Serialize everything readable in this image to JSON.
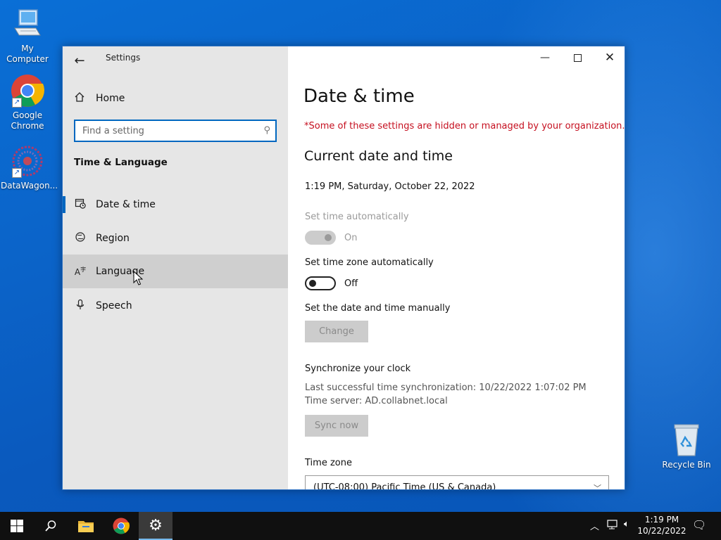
{
  "desktop": {
    "icons": [
      {
        "label": "My Computer",
        "icon": "computer-icon"
      },
      {
        "label": "Google Chrome",
        "icon": "chrome-icon"
      },
      {
        "label": "DataWagon...",
        "icon": "datawagon-icon"
      },
      {
        "label": "Recycle Bin",
        "icon": "recycle-bin-icon"
      }
    ]
  },
  "window": {
    "app_title": "Settings",
    "nav": {
      "home_label": "Home",
      "search_placeholder": "Find a setting",
      "section_title": "Time & Language",
      "items": [
        {
          "label": "Date & time",
          "icon": "date-time-icon",
          "selected": true
        },
        {
          "label": "Region",
          "icon": "region-globe-icon"
        },
        {
          "label": "Language",
          "icon": "language-icon",
          "hovered": true
        },
        {
          "label": "Speech",
          "icon": "microphone-icon"
        }
      ]
    },
    "content": {
      "title": "Date & time",
      "org_note": "*Some of these settings are hidden or managed by your organization.",
      "section_heading": "Current date and time",
      "current_datetime": "1:19 PM, Saturday, October 22, 2022",
      "set_time_auto": {
        "label": "Set time automatically",
        "state": "On"
      },
      "set_tz_auto": {
        "label": "Set time zone automatically",
        "state": "Off"
      },
      "manual": {
        "label": "Set the date and time manually",
        "button": "Change"
      },
      "sync": {
        "heading": "Synchronize your clock",
        "last_sync": "Last successful time synchronization: 10/22/2022 1:07:02 PM",
        "time_server": "Time server: AD.collabnet.local",
        "button": "Sync now"
      },
      "time_zone": {
        "label": "Time zone",
        "value": "(UTC-08:00) Pacific Time (US & Canada)"
      }
    }
  },
  "taskbar": {
    "clock_time": "1:19 PM",
    "clock_date": "10/22/2022"
  },
  "colors": {
    "accent": "#0067c0",
    "warning_text": "#c50f1f",
    "taskbar": "#101010"
  }
}
